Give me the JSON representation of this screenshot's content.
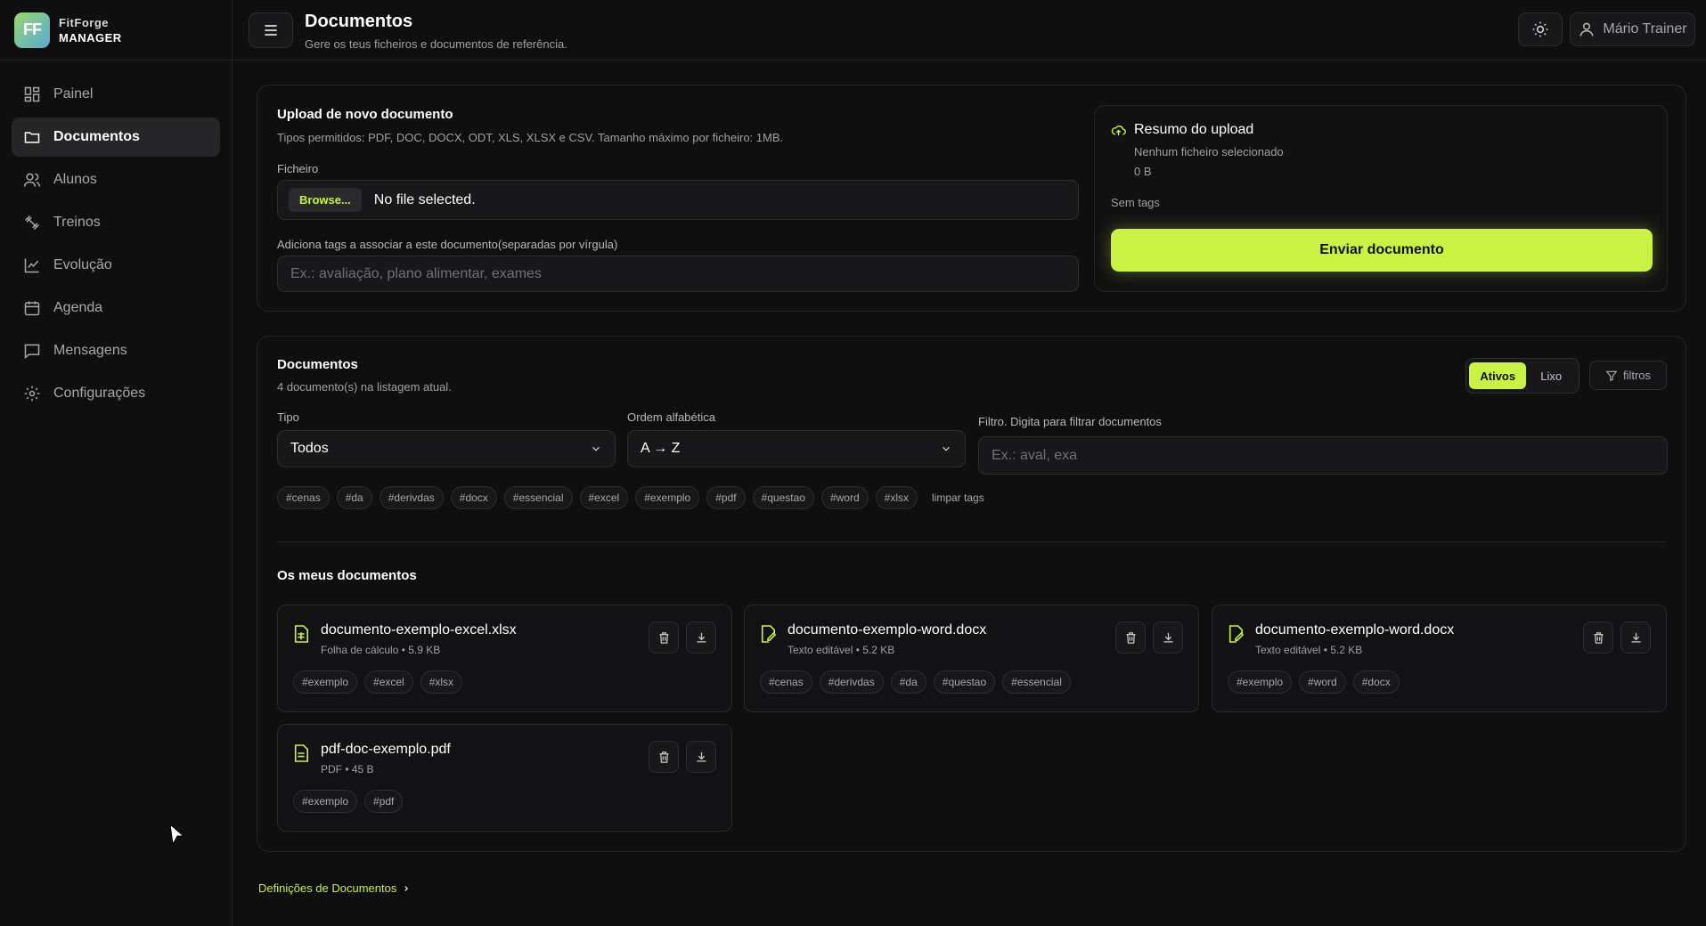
{
  "brand": {
    "logo_text": "FF",
    "name": "FitForge",
    "sub": "MANAGER"
  },
  "sidebar": {
    "items": [
      {
        "label": "Painel",
        "icon": "dashboard-icon"
      },
      {
        "label": "Documentos",
        "icon": "folder-icon",
        "active": true
      },
      {
        "label": "Alunos",
        "icon": "users-icon"
      },
      {
        "label": "Treinos",
        "icon": "dumbbell-icon"
      },
      {
        "label": "Evolução",
        "icon": "chart-line-icon"
      },
      {
        "label": "Agenda",
        "icon": "calendar-icon"
      },
      {
        "label": "Mensagens",
        "icon": "message-icon"
      },
      {
        "label": "Configurações",
        "icon": "gear-icon"
      }
    ]
  },
  "header": {
    "title": "Documentos",
    "subtitle": "Gere os teus ficheiros e documentos de referência.",
    "user": "Mário Trainer"
  },
  "upload": {
    "title": "Upload de novo documento",
    "hint": "Tipos permitidos: PDF, DOC, DOCX, ODT, XLS, XLSX e CSV. Tamanho máximo por ficheiro: 1MB.",
    "file_label": "Ficheiro",
    "browse": "Browse...",
    "no_file": "No file selected.",
    "tags_label": "Adiciona tags a associar a este documento(separadas por vírgula)",
    "tags_placeholder": "Ex.: avaliação, plano alimentar, exames"
  },
  "summary": {
    "title": "Resumo do upload",
    "file": "Nenhum ficheiro selecionado",
    "size": "0 B",
    "tags": "Sem tags",
    "send": "Enviar documento"
  },
  "documents": {
    "title": "Documentos",
    "count": "4 documento(s) na listagem atual.",
    "seg_active": "Ativos",
    "seg_trash": "Lixo",
    "filters": "filtros",
    "type_label": "Tipo",
    "type_value": "Todos",
    "order_label": "Ordem alfabética",
    "order_value": "A → Z",
    "filter_label": "Filtro. Digita para filtrar documentos",
    "filter_placeholder": "Ex.: aval, exa",
    "tags": [
      "#cenas",
      "#da",
      "#derivdas",
      "#docx",
      "#essencial",
      "#excel",
      "#exemplo",
      "#pdf",
      "#questao",
      "#word",
      "#xlsx"
    ],
    "clear_tags": "limpar tags",
    "my_docs": "Os meus documentos",
    "cards": [
      {
        "name": "documento-exemplo-excel.xlsx",
        "meta": "Folha de cálculo • 5.9 KB",
        "icon": "spreadsheet-icon",
        "tags": [
          "#exemplo",
          "#excel",
          "#xlsx"
        ]
      },
      {
        "name": "documento-exemplo-word.docx",
        "meta": "Texto editável • 5.2 KB",
        "icon": "edit-document-icon",
        "tags": [
          "#cenas",
          "#derivdas",
          "#da",
          "#questao",
          "#essencial"
        ]
      },
      {
        "name": "documento-exemplo-word.docx",
        "meta": "Texto editável • 5.2 KB",
        "icon": "edit-document-icon",
        "tags": [
          "#exemplo",
          "#word",
          "#docx"
        ]
      },
      {
        "name": "pdf-doc-exemplo.pdf",
        "meta": "PDF • 45 B",
        "icon": "document-icon",
        "tags": [
          "#exemplo",
          "#pdf"
        ]
      }
    ]
  },
  "footer": {
    "link": "Definições de Documentos"
  },
  "colors": {
    "accent": "#c8f244",
    "background": "#0e0e0f"
  }
}
